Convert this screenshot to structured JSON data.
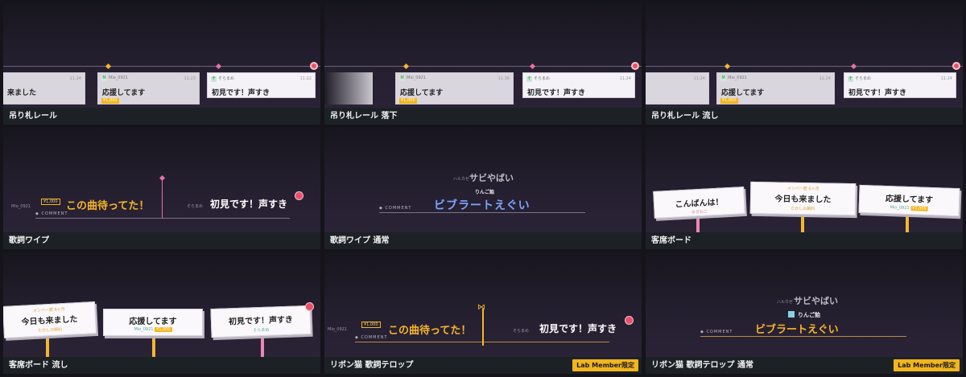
{
  "cards": [
    {
      "caption": "吊り札レール",
      "tags": [
        {
          "who": "",
          "time": "11:24",
          "msg": "来ました",
          "yen": ""
        },
        {
          "who": "Mio_0921",
          "time": "11:23",
          "msg": "応援してます",
          "yen": "¥1,000"
        },
        {
          "who": "そらまめ",
          "time": "11:22",
          "msg": "初見です！声すき",
          "yen": ""
        }
      ]
    },
    {
      "caption": "吊り札レール 落下",
      "tags": [
        {
          "who": "",
          "time": "11:24",
          "msg": "",
          "yen": ""
        },
        {
          "who": "Mio_0921",
          "time": "11:36",
          "msg": "応援してます",
          "yen": "¥1,000"
        },
        {
          "who": "そらまめ",
          "time": "11:24",
          "msg": "初見です！声すき",
          "yen": ""
        }
      ]
    },
    {
      "caption": "吊り札レール 流し",
      "tags": [
        {
          "who": "",
          "time": "11:24",
          "msg": "",
          "yen": ""
        },
        {
          "who": "Mio_0921",
          "time": "11:24",
          "msg": "応援してます",
          "yen": "¥1,000"
        },
        {
          "who": "そらまめ",
          "time": "11:24",
          "msg": "初見です！声すき",
          "yen": ""
        }
      ]
    },
    {
      "caption": "歌詞ワイプ",
      "name_left": "Mio_0921",
      "yen": "¥1,000",
      "comment": "COMMENT",
      "lyric_gold": "この曲待ってた！",
      "name_right": "そらまめ",
      "lyric_white": "初見です！声すき"
    },
    {
      "caption": "歌詞ワイプ 通常",
      "top_name": "ハルカゼ",
      "top_text": "サビやばい",
      "mid_name": "りんご飴",
      "comment": "COMMENT",
      "lyric_blue": "ビブラートえぐい"
    },
    {
      "caption": "客席ボード",
      "boards": [
        {
          "msg": "こんばんは！",
          "sub": "ゆきねこ"
        },
        {
          "msg": "今日も来ました",
          "top": "メンバー歴 6ヶ月",
          "sub": "たかしの飼料"
        },
        {
          "msg": "応援してます",
          "sub": "Mio_0921",
          "yen": "¥1,000"
        }
      ]
    },
    {
      "caption": "客席ボード 流し",
      "boards": [
        {
          "msg": "今日も来ました",
          "top": "メンバー歴 6ヶ月",
          "sub": "たかしの飼料"
        },
        {
          "msg": "応援してます",
          "sub": "Mio_0921",
          "yen": "¥1,000"
        },
        {
          "msg": "初見です！声すき",
          "sub": "そらまめ"
        }
      ]
    },
    {
      "caption": "リボン猫 歌詞テロップ",
      "badge": "Lab Member限定",
      "name_left": "Mio_0921",
      "yen": "¥1,000",
      "comment": "COMMENT",
      "lyric_gold": "この曲待ってた！",
      "name_right": "そらまめ",
      "lyric_white": "初見です！声すき"
    },
    {
      "caption": "リボン猫 歌詞テロップ 通常",
      "badge": "Lab Member限定",
      "top_name": "ハルカゼ",
      "top_text": "サビやばい",
      "mid_name": "りんご飴",
      "comment": "COMMENT",
      "lyric_gold": "ビブラートえぐい"
    }
  ],
  "colors": {
    "accent_gold": "#f3b51c",
    "accent_pink": "#e8506a",
    "lyric_blue": "#7fa3ff"
  }
}
